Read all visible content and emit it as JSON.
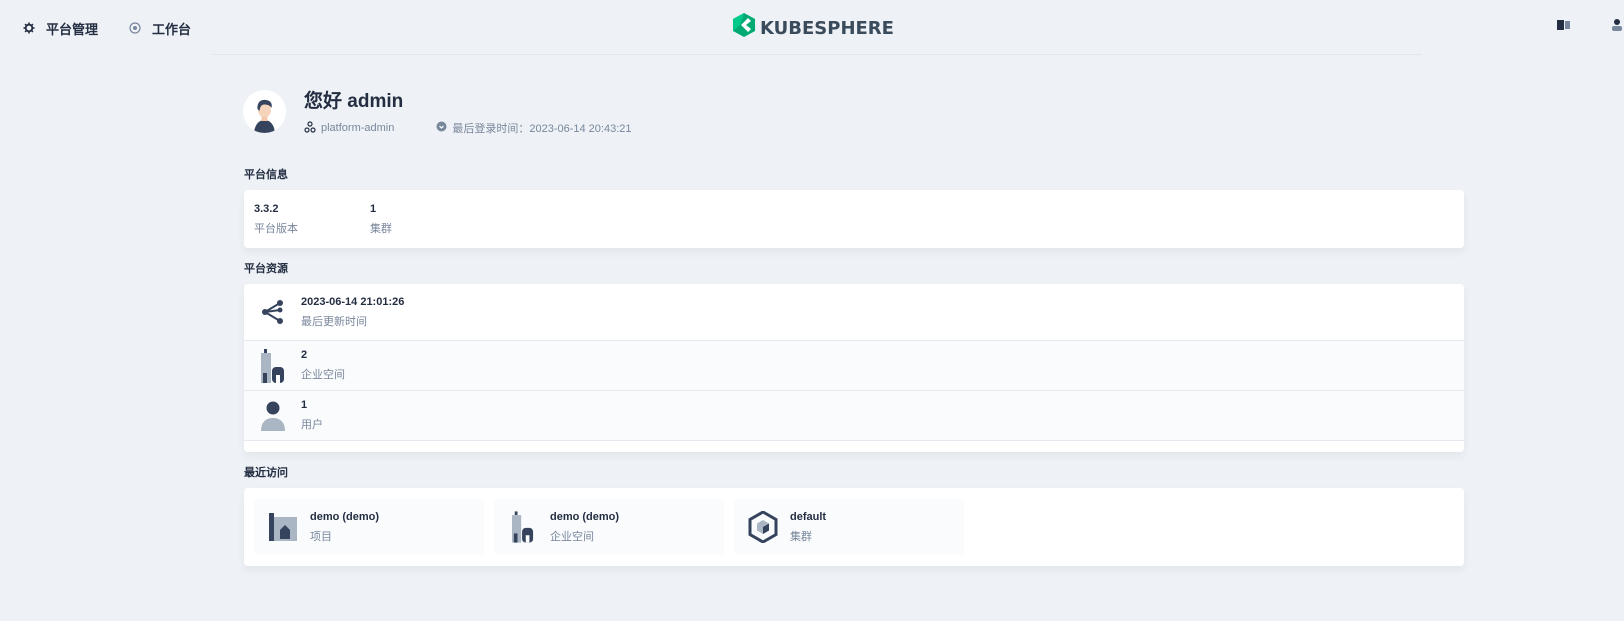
{
  "topbar": {
    "nav": [
      {
        "label": "平台管理",
        "icon": "gear-icon"
      },
      {
        "label": "工作台",
        "icon": "workbench-icon"
      }
    ],
    "brand": "KUBESPHERE",
    "brand_color": "#00aa72"
  },
  "greeting": {
    "hello": "您好 admin",
    "role": "platform-admin",
    "last_login": "最后登录时间：2023-06-14 20:43:21"
  },
  "platform_info": {
    "title": "平台信息",
    "items": [
      {
        "value": "3.3.2",
        "label": "平台版本"
      },
      {
        "value": "1",
        "label": "集群"
      }
    ]
  },
  "platform_resources": {
    "title": "平台资源",
    "rows": [
      {
        "value": "2023-06-14 21:01:26",
        "label": "最后更新时间",
        "icon": "share-nodes-icon"
      },
      {
        "value": "2",
        "label": "企业空间",
        "icon": "workspace-icon"
      },
      {
        "value": "1",
        "label": "用户",
        "icon": "user-icon"
      }
    ]
  },
  "recent": {
    "title": "最近访问",
    "items": [
      {
        "name": "demo (demo)",
        "type": "项目",
        "icon": "project-icon"
      },
      {
        "name": "demo (demo)",
        "type": "企业空间",
        "icon": "workspace-icon"
      },
      {
        "name": "default",
        "type": "集群",
        "icon": "cluster-icon"
      }
    ]
  },
  "colors": {
    "background": "#eef2f6",
    "text_primary": "#242e42",
    "text_secondary": "#79879c"
  }
}
